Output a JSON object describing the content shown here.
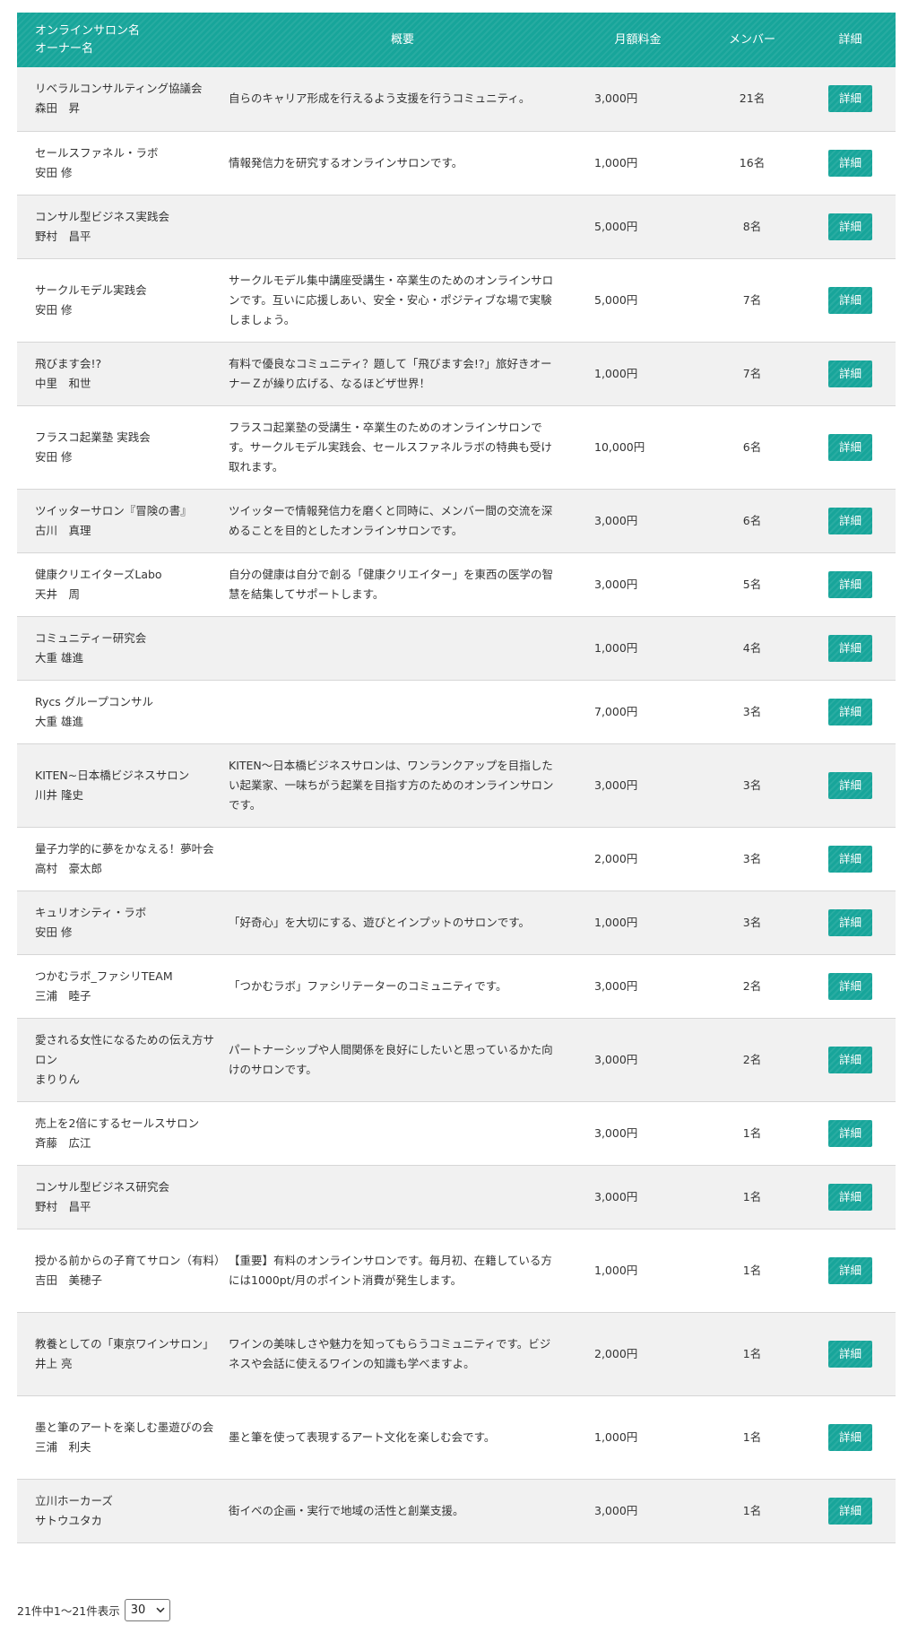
{
  "table": {
    "headers": {
      "salon_name": "オンラインサロン名",
      "owner_name": "オーナー名",
      "description": "概要",
      "monthly_fee": "月額料金",
      "members": "メンバー",
      "details": "詳細"
    },
    "detail_label": "詳細",
    "rows": [
      {
        "name": "リベラルコンサルティング協議会",
        "owner": "森田　昇",
        "description": "自らのキャリア形成を行えるよう支援を行うコミュニティ。",
        "fee": "3,000円",
        "members": "21名"
      },
      {
        "name": "セールスファネル・ラボ",
        "owner": "安田 修",
        "description": "情報発信力を研究するオンラインサロンです。",
        "fee": "1,000円",
        "members": "16名"
      },
      {
        "name": "コンサル型ビジネス実践会",
        "owner": "野村　昌平",
        "description": "",
        "fee": "5,000円",
        "members": "8名"
      },
      {
        "name": "サークルモデル実践会",
        "owner": "安田 修",
        "description": "サークルモデル集中講座受講生・卒業生のためのオンラインサロンです。互いに応援しあい、安全・安心・ポジティブな場で実験しましょう。",
        "fee": "5,000円",
        "members": "7名"
      },
      {
        "name": "飛びます会!?",
        "owner": "中里　和世",
        "description": "有料で優良なコミュニティ？題して「飛びます会!?」旅好きオーナーＺが繰り広げる、なるほどザ世界！",
        "fee": "1,000円",
        "members": "7名"
      },
      {
        "name": "フラスコ起業塾 実践会",
        "owner": "安田 修",
        "description": "フラスコ起業塾の受講生・卒業生のためのオンラインサロンです。サークルモデル実践会、セールスファネルラボの特典も受け取れます。",
        "fee": "10,000円",
        "members": "6名"
      },
      {
        "name": "ツイッターサロン『冒険の書』",
        "owner": "古川　真理",
        "description": "ツイッターで情報発信力を磨くと同時に、メンバー間の交流を深めることを目的としたオンラインサロンです。",
        "fee": "3,000円",
        "members": "6名"
      },
      {
        "name": "健康クリエイターズLabo",
        "owner": "天井　周",
        "description": "自分の健康は自分で創る「健康クリエイター」を東西の医学の智慧を結集してサポートします。",
        "fee": "3,000円",
        "members": "5名"
      },
      {
        "name": "コミュニティー研究会",
        "owner": "大重 雄進",
        "description": "",
        "fee": "1,000円",
        "members": "4名"
      },
      {
        "name": "Rycs グループコンサル",
        "owner": "大重 雄進",
        "description": "",
        "fee": "7,000円",
        "members": "3名"
      },
      {
        "name": "KITEN~日本橋ビジネスサロン",
        "owner": "川井 隆史",
        "description": "KITEN～日本橋ビジネスサロンは、ワンランクアップを目指したい起業家、一味ちがう起業を目指す方のためのオンラインサロンです。",
        "fee": "3,000円",
        "members": "3名"
      },
      {
        "name": "量子力学的に夢をかなえる！夢叶会",
        "owner": "高村　豪太郎",
        "description": "",
        "fee": "2,000円",
        "members": "3名"
      },
      {
        "name": "キュリオシティ・ラボ",
        "owner": "安田 修",
        "description": "「好奇心」を大切にする、遊びとインプットのサロンです。",
        "fee": "1,000円",
        "members": "3名"
      },
      {
        "name": "つかむラボ_ファシリTEAM",
        "owner": "三浦　睦子",
        "description": "「つかむラボ」ファシリテーターのコミュニティです。",
        "fee": "3,000円",
        "members": "2名"
      },
      {
        "name": "愛される女性になるための伝え方サロン",
        "owner": "まりりん",
        "description": "パートナーシップや人間関係を良好にしたいと思っているかた向けのサロンです。",
        "fee": "3,000円",
        "members": "2名"
      },
      {
        "name": "売上を2倍にするセールスサロン",
        "owner": "斉藤　広江",
        "description": "",
        "fee": "3,000円",
        "members": "1名"
      },
      {
        "name": "コンサル型ビジネス研究会",
        "owner": "野村　昌平",
        "description": "",
        "fee": "3,000円",
        "members": "1名"
      },
      {
        "name": "授かる前からの子育てサロン（有料）",
        "owner": "吉田　美穂子",
        "description": "【重要】有料のオンラインサロンです。毎月初、在籍している方には1000pt/月のポイント消費が発生します。",
        "fee": "1,000円",
        "members": "1名"
      },
      {
        "name": "教養としての「東京ワインサロン」",
        "owner": "井上 亮",
        "description": "ワインの美味しさや魅力を知ってもらうコミュニティです。ビジネスや会話に使えるワインの知識も学べますよ。",
        "fee": "2,000円",
        "members": "1名"
      },
      {
        "name": "墨と筆のアートを楽しむ墨遊びの会",
        "owner": "三浦　利夫",
        "description": "墨と筆を使って表現するアート文化を楽しむ会です。",
        "fee": "1,000円",
        "members": "1名"
      },
      {
        "name": "立川ホーカーズ",
        "owner": "サトウユタカ",
        "description": "街イベの企画・実行で地域の活性と創業支援。",
        "fee": "3,000円",
        "members": "1名"
      }
    ]
  },
  "pagination": {
    "summary": "21件中1～21件表示",
    "page_size": "30"
  },
  "colors": {
    "accent": "#17a59a",
    "row_stripe": "#f1f1f1"
  },
  "icons": {
    "select_arrow": "chevron-down-icon"
  }
}
